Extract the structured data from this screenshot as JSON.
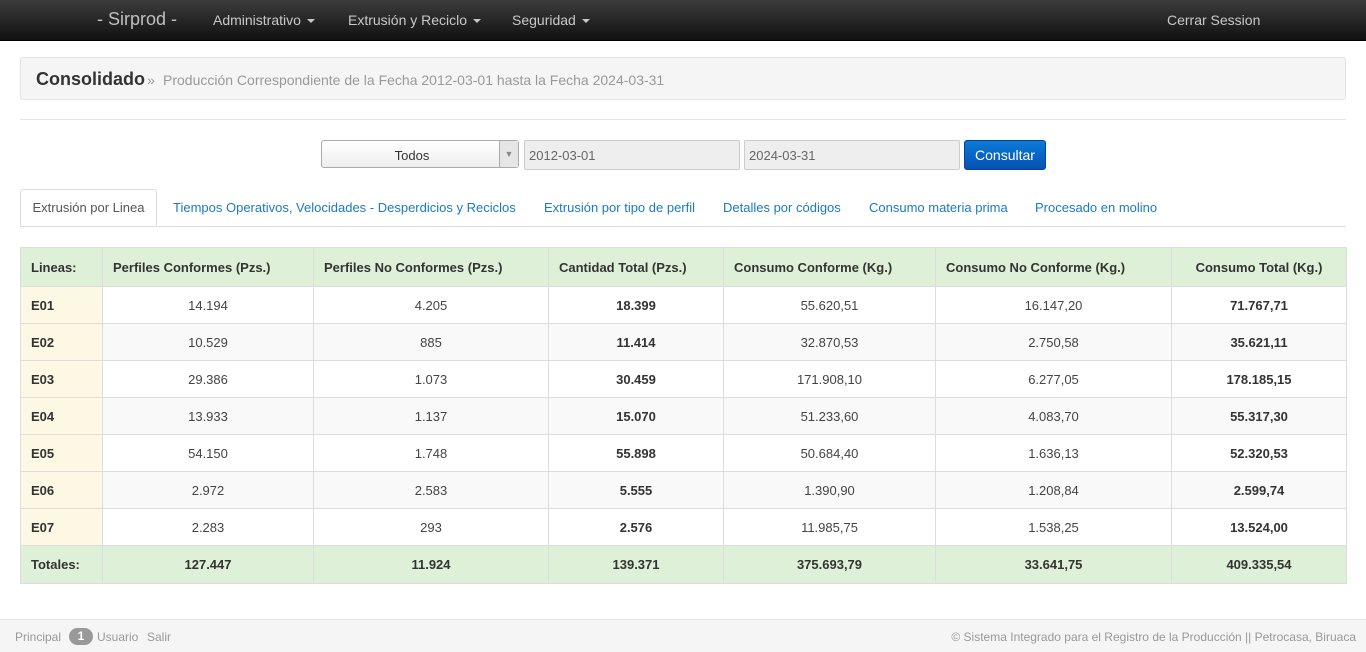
{
  "navbar": {
    "brand": "- Sirprod -",
    "menus": [
      "Administrativo",
      "Extrusión y Reciclo",
      "Seguridad"
    ],
    "logout": "Cerrar Session"
  },
  "header": {
    "title": "Consolidado",
    "separator": "»",
    "subtitle": "Producción Correspondiente de la Fecha 2012-03-01 hasta la Fecha 2024-03-31"
  },
  "filters": {
    "select_value": "Todos",
    "date_from": "2012-03-01",
    "date_to": "2024-03-31",
    "submit_label": "Consultar",
    "accent_color": "#0552b5"
  },
  "tabs": [
    {
      "label": "Extrusión por Linea",
      "active": true
    },
    {
      "label": "Tiempos Operativos, Velocidades - Desperdicios y Reciclos"
    },
    {
      "label": "Extrusión por tipo de perfil"
    },
    {
      "label": "Detalles por códigos"
    },
    {
      "label": "Consumo materia prima"
    },
    {
      "label": "Procesado en molino"
    }
  ],
  "table": {
    "headers": [
      "Lineas:",
      "Perfiles Conformes (Pzs.)",
      "Perfiles No Conformes (Pzs.)",
      "Cantidad Total (Pzs.)",
      "Consumo Conforme (Kg.)",
      "Consumo No Conforme (Kg.)",
      "Consumo Total (Kg.)"
    ],
    "rows": [
      [
        "E01",
        "14.194",
        "4.205",
        "18.399",
        "55.620,51",
        "16.147,20",
        "71.767,71"
      ],
      [
        "E02",
        "10.529",
        "885",
        "11.414",
        "32.870,53",
        "2.750,58",
        "35.621,11"
      ],
      [
        "E03",
        "29.386",
        "1.073",
        "30.459",
        "171.908,10",
        "6.277,05",
        "178.185,15"
      ],
      [
        "E04",
        "13.933",
        "1.137",
        "15.070",
        "51.233,60",
        "4.083,70",
        "55.317,30"
      ],
      [
        "E05",
        "54.150",
        "1.748",
        "55.898",
        "50.684,40",
        "1.636,13",
        "52.320,53"
      ],
      [
        "E06",
        "2.972",
        "2.583",
        "5.555",
        "1.390,90",
        "1.208,84",
        "2.599,74"
      ],
      [
        "E07",
        "2.283",
        "293",
        "2.576",
        "11.985,75",
        "1.538,25",
        "13.524,00"
      ]
    ],
    "totals": [
      "Totales:",
      "127.447",
      "11.924",
      "139.371",
      "375.693,79",
      "33.641,75",
      "409.335,54"
    ]
  },
  "footer": {
    "principal": "Principal",
    "badge": "1",
    "usuario": "Usuario",
    "salir": "Salir",
    "copyright": "© Sistema Integrado para el Registro de la Producción || Petrocasa, Biruaca"
  }
}
